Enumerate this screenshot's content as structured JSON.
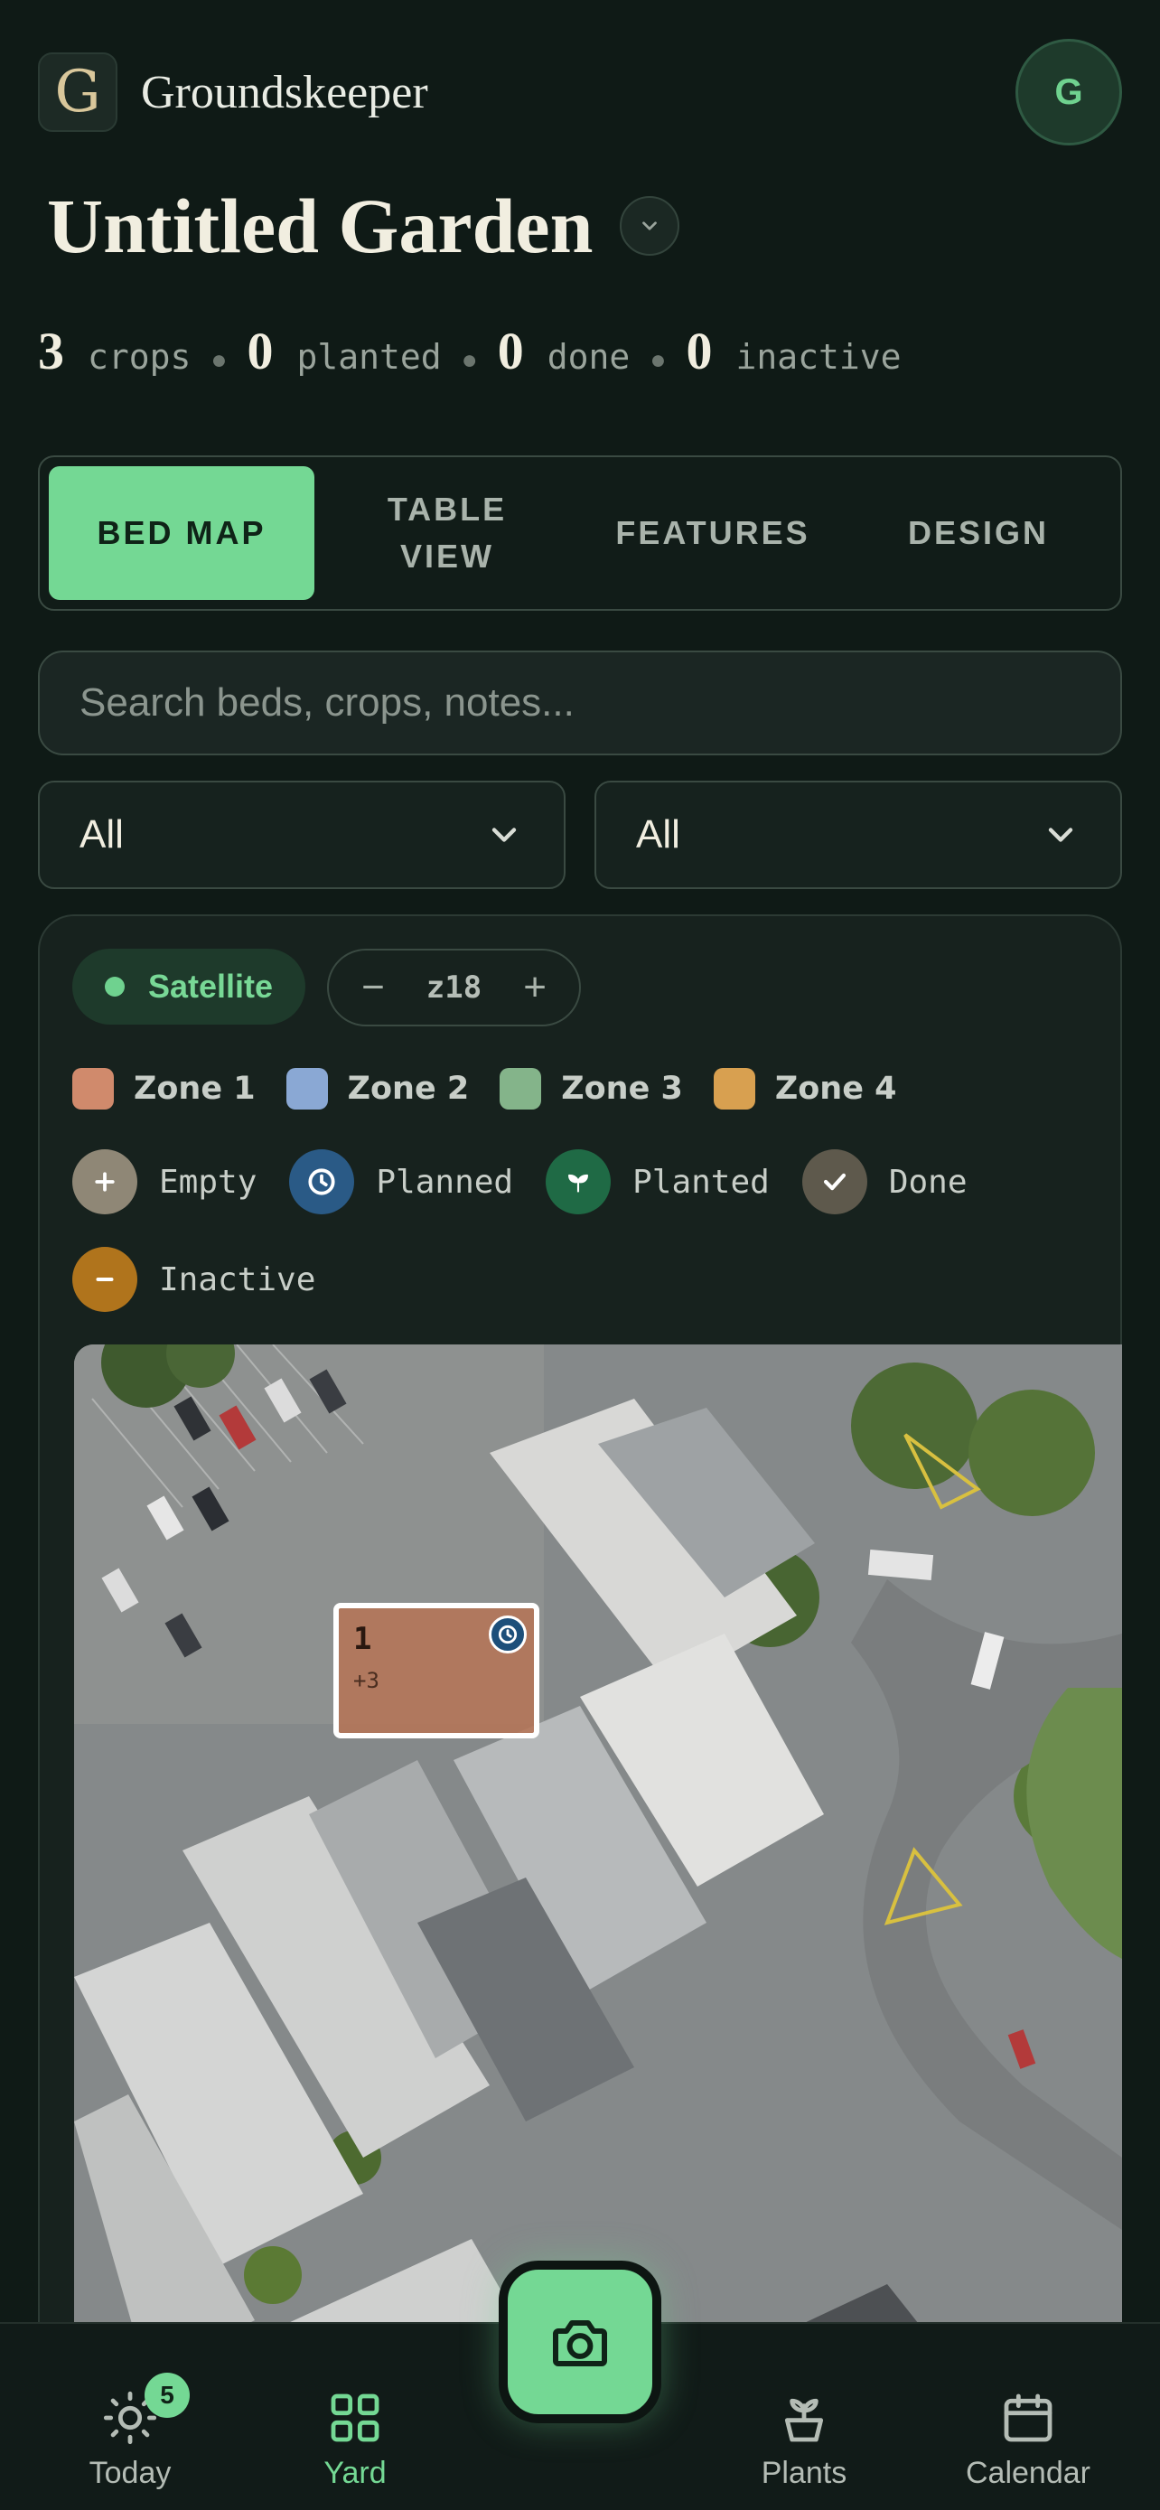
{
  "app": {
    "name": "Groundskeeper",
    "logo_letter": "G",
    "avatar_initial": "G"
  },
  "page": {
    "title": "Untitled Garden"
  },
  "stats": [
    {
      "value": "3",
      "label": "crops"
    },
    {
      "value": "0",
      "label": "planted"
    },
    {
      "value": "0",
      "label": "done"
    },
    {
      "value": "0",
      "label": "inactive"
    }
  ],
  "tabs": [
    {
      "label": "BED MAP",
      "active": true
    },
    {
      "label": "TABLE\nVIEW",
      "active": false
    },
    {
      "label": "FEATURES",
      "active": false
    },
    {
      "label": "DESIGN",
      "active": false
    }
  ],
  "search": {
    "placeholder": "Search beds, crops, notes..."
  },
  "filters": [
    {
      "value": "All"
    },
    {
      "value": "All"
    }
  ],
  "map": {
    "layer_label": "Satellite",
    "zoom_minus": "−",
    "zoom_level": "z18",
    "zoom_plus": "+",
    "zones": [
      {
        "label": "Zone 1",
        "color": "#d08a6c"
      },
      {
        "label": "Zone 2",
        "color": "#8aa8d4"
      },
      {
        "label": "Zone 3",
        "color": "#84b48a"
      },
      {
        "label": "Zone 4",
        "color": "#d8a050"
      }
    ],
    "legend": [
      {
        "label": "Empty",
        "icon": "plus-icon",
        "color": "#8f8776"
      },
      {
        "label": "Planned",
        "icon": "clock-icon",
        "color": "#2a5a86"
      },
      {
        "label": "Planted",
        "icon": "sprout-icon",
        "color": "#1f6a45"
      },
      {
        "label": "Done",
        "icon": "check-icon",
        "color": "#5e594c"
      },
      {
        "label": "Inactive",
        "icon": "minus-icon",
        "color": "#b0741c"
      }
    ],
    "bed": {
      "number": "1",
      "extra": "+3",
      "status": "Planned"
    }
  },
  "bottom_nav": {
    "today": {
      "label": "Today",
      "badge": "5"
    },
    "yard": {
      "label": "Yard"
    },
    "plants": {
      "label": "Plants"
    },
    "calendar": {
      "label": "Calendar"
    }
  }
}
